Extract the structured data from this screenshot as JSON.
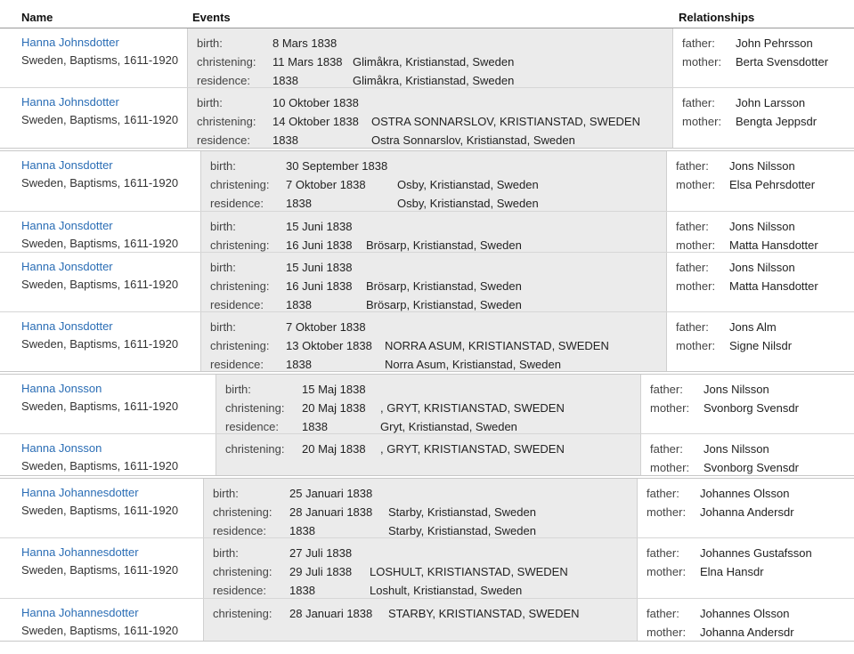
{
  "headers": {
    "name": "Name",
    "events": "Events",
    "relationships": "Relationships"
  },
  "labels": {
    "birth": "birth:",
    "christening": "christening:",
    "residence": "residence:",
    "father": "father:",
    "mother": "mother:"
  },
  "groups": [
    {
      "rows": [
        {
          "name": "Hanna Johnsdotter",
          "collection": "Sweden, Baptisms, 1611-1920",
          "events": [
            {
              "type": "birth",
              "date": "8 Mars 1838",
              "place": ""
            },
            {
              "type": "christening",
              "date": "11 Mars 1838",
              "place": "Glimåkra, Kristianstad, Sweden"
            },
            {
              "type": "residence",
              "date": "1838",
              "place": "Glimåkra, Kristianstad, Sweden"
            }
          ],
          "father": "John Pehrsson",
          "mother": "Berta Svensdotter"
        },
        {
          "name": "Hanna Johnsdotter",
          "collection": "Sweden, Baptisms, 1611-1920",
          "events": [
            {
              "type": "birth",
              "date": "10 Oktober 1838",
              "place": ""
            },
            {
              "type": "christening",
              "date": "14 Oktober 1838",
              "place": "OSTRA SONNARSLOV, KRISTIANSTAD, SWEDEN"
            },
            {
              "type": "residence",
              "date": "1838",
              "place": "Ostra Sonnarslov, Kristianstad, Sweden"
            }
          ],
          "father": "John Larsson",
          "mother": "Bengta Jeppsdr"
        }
      ]
    },
    {
      "rows": [
        {
          "name": "Hanna Jonsdotter",
          "collection": "Sweden, Baptisms, 1611-1920",
          "events": [
            {
              "type": "birth",
              "date": "30 September 1838",
              "place": ""
            },
            {
              "type": "christening",
              "date": "7 Oktober 1838",
              "place": "Osby, Kristianstad, Sweden"
            },
            {
              "type": "residence",
              "date": "1838",
              "place": "Osby, Kristianstad, Sweden"
            }
          ],
          "father": "Jons Nilsson",
          "mother": "Elsa Pehrsdotter"
        },
        {
          "name": "Hanna Jonsdotter",
          "collection": "Sweden, Baptisms, 1611-1920",
          "events": [
            {
              "type": "birth",
              "date": "15 Juni 1838",
              "place": ""
            },
            {
              "type": "christening",
              "date": "16 Juni 1838",
              "place": "Brösarp, Kristianstad, Sweden"
            }
          ],
          "father": "Jons Nilsson",
          "mother": "Matta Hansdotter"
        },
        {
          "name": "Hanna Jonsdotter",
          "collection": "Sweden, Baptisms, 1611-1920",
          "events": [
            {
              "type": "birth",
              "date": "15 Juni 1838",
              "place": ""
            },
            {
              "type": "christening",
              "date": "16 Juni 1838",
              "place": "Brösarp, Kristianstad, Sweden"
            },
            {
              "type": "residence",
              "date": "1838",
              "place": "Brösarp, Kristianstad, Sweden"
            }
          ],
          "father": "Jons Nilsson",
          "mother": "Matta Hansdotter"
        },
        {
          "name": "Hanna Jonsdotter",
          "collection": "Sweden, Baptisms, 1611-1920",
          "events": [
            {
              "type": "birth",
              "date": "7 Oktober 1838",
              "place": ""
            },
            {
              "type": "christening",
              "date": "13 Oktober 1838",
              "place": "NORRA ASUM, KRISTIANSTAD, SWEDEN"
            },
            {
              "type": "residence",
              "date": "1838",
              "place": "Norra Asum, Kristianstad, Sweden"
            }
          ],
          "father": "Jons Alm",
          "mother": "Signe Nilsdr"
        }
      ]
    },
    {
      "rows": [
        {
          "name": "Hanna Jonsson",
          "collection": "Sweden, Baptisms, 1611-1920",
          "events": [
            {
              "type": "birth",
              "date": "15 Maj 1838",
              "place": ""
            },
            {
              "type": "christening",
              "date": "20 Maj 1838",
              "place": ", GRYT, KRISTIANSTAD, SWEDEN"
            },
            {
              "type": "residence",
              "date": "1838",
              "place": "Gryt, Kristianstad, Sweden"
            }
          ],
          "father": "Jons Nilsson",
          "mother": "Svonborg Svensdr"
        },
        {
          "name": "Hanna Jonsson",
          "collection": "Sweden, Baptisms, 1611-1920",
          "events": [
            {
              "type": "christening",
              "date": "20 Maj 1838",
              "place": ", GRYT, KRISTIANSTAD, SWEDEN"
            }
          ],
          "father": "Jons Nilsson",
          "mother": "Svonborg Svensdr"
        }
      ]
    },
    {
      "rows": [
        {
          "name": "Hanna Johannesdotter",
          "collection": "Sweden, Baptisms, 1611-1920",
          "events": [
            {
              "type": "birth",
              "date": "25 Januari 1838",
              "place": ""
            },
            {
              "type": "christening",
              "date": "28 Januari 1838",
              "place": "Starby, Kristianstad, Sweden"
            },
            {
              "type": "residence",
              "date": "1838",
              "place": "Starby, Kristianstad, Sweden"
            }
          ],
          "father": "Johannes Olsson",
          "mother": "Johanna Andersdr"
        },
        {
          "name": "Hanna Johannesdotter",
          "collection": "Sweden, Baptisms, 1611-1920",
          "events": [
            {
              "type": "birth",
              "date": "27 Juli 1838",
              "place": ""
            },
            {
              "type": "christening",
              "date": "29 Juli 1838",
              "place": "LOSHULT, KRISTIANSTAD, SWEDEN"
            },
            {
              "type": "residence",
              "date": "1838",
              "place": "Loshult, Kristianstad, Sweden"
            }
          ],
          "father": "Johannes Gustafsson",
          "mother": "Elna Hansdr"
        },
        {
          "name": "Hanna Johannesdotter",
          "collection": "Sweden, Baptisms, 1611-1920",
          "events": [
            {
              "type": "christening",
              "date": "28 Januari 1838",
              "place": "STARBY, KRISTIANSTAD, SWEDEN"
            }
          ],
          "father": "Johannes Olsson",
          "mother": "Johanna Andersdr"
        }
      ]
    }
  ]
}
